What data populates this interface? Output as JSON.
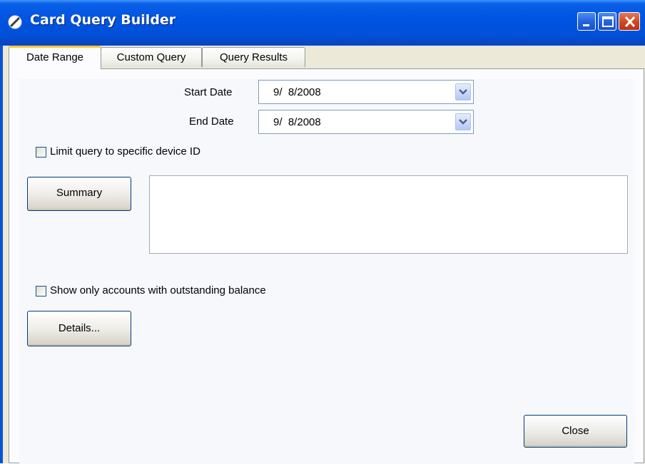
{
  "window": {
    "title": "Card Query Builder",
    "icon": "no-entry-icon",
    "controls": [
      "minimize-icon",
      "maximize-icon",
      "close-icon"
    ]
  },
  "tabs": [
    {
      "label": "Date Range",
      "active": true
    },
    {
      "label": "Custom Query",
      "active": false
    },
    {
      "label": "Query Results",
      "active": false
    }
  ],
  "date_range": {
    "start_label": "Start Date",
    "start_value": "9/  8/2008",
    "end_label": "End Date",
    "end_value": "9/  8/2008"
  },
  "limit_device": {
    "label": "Limit query to specific device ID",
    "checked": false
  },
  "summary_button": "Summary",
  "summary_text": "",
  "outstanding_balance": {
    "label": "Show only accounts with outstanding balance",
    "checked": false
  },
  "details_button": "Details...",
  "close_button": "Close",
  "colors": {
    "titlebar": "#0054e3",
    "active_tab_highlight": "#ffc83c",
    "close_button_red": "#d2471f"
  }
}
